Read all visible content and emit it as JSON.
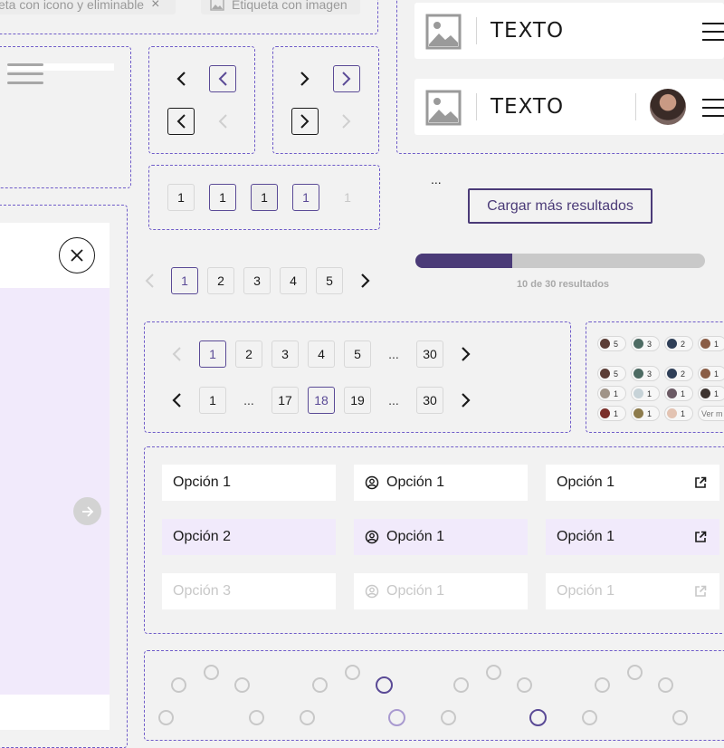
{
  "chips": {
    "removable": "eta con icono y eliminable",
    "image": "Etiqueta con imagen"
  },
  "navbars": [
    {
      "text": "TEXTO",
      "has_avatar": false
    },
    {
      "text": "TEXTO",
      "has_avatar": true
    }
  ],
  "simple_pager_boxes": [
    "1",
    "1",
    "1",
    "1",
    "1"
  ],
  "loader": {
    "ellipsis": "...",
    "load_more": "Cargar más resultados",
    "progress_fraction": 0.333,
    "progress_text": "10 de 30 resultados"
  },
  "pagination_a": [
    "1",
    "2",
    "3",
    "4",
    "5"
  ],
  "pagination_b": [
    "1",
    "2",
    "3",
    "4",
    "5",
    "...",
    "30"
  ],
  "pagination_c": [
    "1",
    "...",
    "17",
    "18",
    "19",
    "...",
    "30"
  ],
  "reactions": {
    "row1": [
      "5",
      "3",
      "2",
      "1"
    ],
    "row2": [
      "5",
      "3",
      "2",
      "1"
    ],
    "row3": [
      "1",
      "1",
      "1",
      "1"
    ],
    "row4": [
      "1",
      "1",
      "1",
      "Ver m"
    ]
  },
  "options": {
    "col1": [
      "Opción 1",
      "Opción 2",
      "Opción 3"
    ],
    "col2": [
      "Opción 1",
      "Opción 1",
      "Opción 1"
    ],
    "col3": [
      "Opción 1",
      "Opción 1",
      "Opción 1"
    ]
  },
  "colors": {
    "accent": "#5a4a96",
    "dashed_border": "#6f5cc9",
    "selection_bg": "#f1eafb",
    "progress_fill": "#4b3b78",
    "progress_track": "#c9c9c9"
  }
}
